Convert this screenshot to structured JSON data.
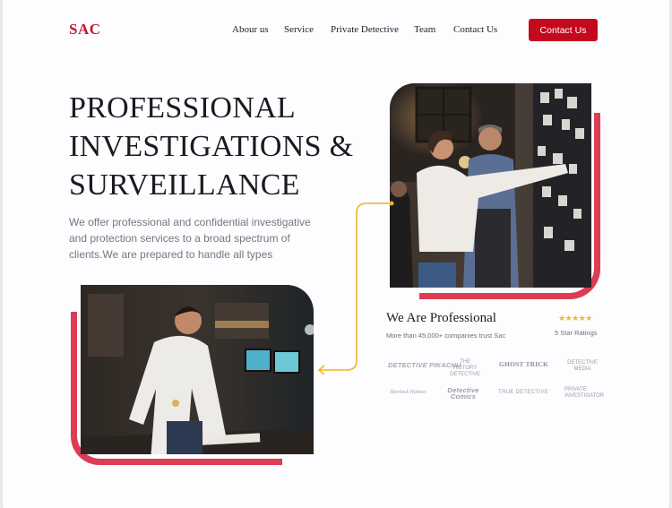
{
  "header": {
    "logo": "SAC",
    "nav": [
      "Abour us",
      "Service",
      "Private Detective",
      "Team",
      "Contact Us"
    ],
    "cta_label": "Contact Us"
  },
  "hero": {
    "title_lines": [
      "PROFESSIONAL",
      "INVESTIGATIONS &",
      "SURVEILLANCE"
    ],
    "description": "We offer professional and confidential investigative and protection services to a broad spectrum of clients.We are prepared to handle all types"
  },
  "about": {
    "title": "We Are Professional",
    "subtitle": "More than 45,000+ companies trust Sac",
    "stars": "★★★★★",
    "rating_label": "5 Star Ratings"
  },
  "partners": [
    {
      "name": "DETECTIVE PIKACHU"
    },
    {
      "name": "THE HISTORY DETECTIVE"
    },
    {
      "name": "GHOST TRICK"
    },
    {
      "name": "DETECTIVE MEDIA"
    },
    {
      "name": "Sherlock Holmes"
    },
    {
      "name": "Detective Comics"
    },
    {
      "name": "TRUE DETECTIVE"
    },
    {
      "name": "PRIVATE INVESTIGATOR"
    }
  ],
  "colors": {
    "brand_red": "#c4091f",
    "frame_red": "#dc3c54",
    "connector_yellow": "#f0b323",
    "star_gold": "#f2b630"
  }
}
